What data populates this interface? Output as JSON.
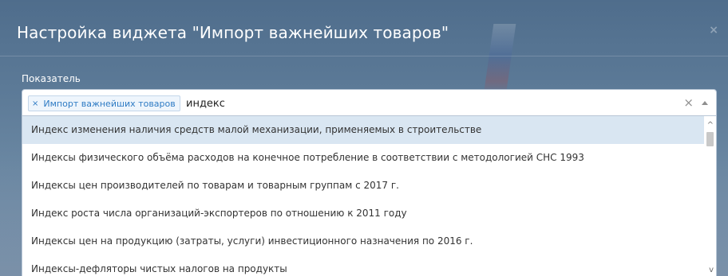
{
  "dialog": {
    "title": "Настройка виджета \"Импорт важнейших товаров\"",
    "close_glyph": "×"
  },
  "field": {
    "label": "Показатель",
    "selected_tag": "Импорт важнейших товаров",
    "tag_remove_glyph": "×",
    "search_value": "индекс",
    "clear_glyph": "×"
  },
  "options": [
    "Индекс изменения наличия средств малой механизации, применяемых в строительстве",
    "Индексы физического объёма расходов на конечное потребление в соответствии с методологией СНС 1993",
    "Индексы цен производителей по товарам и товарным группам с 2017 г.",
    "Индекс роста числа организаций-экспортеров по отношению к 2011 году",
    "Индексы цен на продукцию (затраты, услуги) инвестиционного назначения по 2016 г.",
    "Индексы-дефляторы чистых налогов на продукты"
  ],
  "scroll": {
    "up_glyph": "^",
    "down_glyph": "v"
  },
  "colors": {
    "accent": "#2e7bc4",
    "highlight": "#d9e6f2",
    "modal_bg": "#5d7b98"
  }
}
